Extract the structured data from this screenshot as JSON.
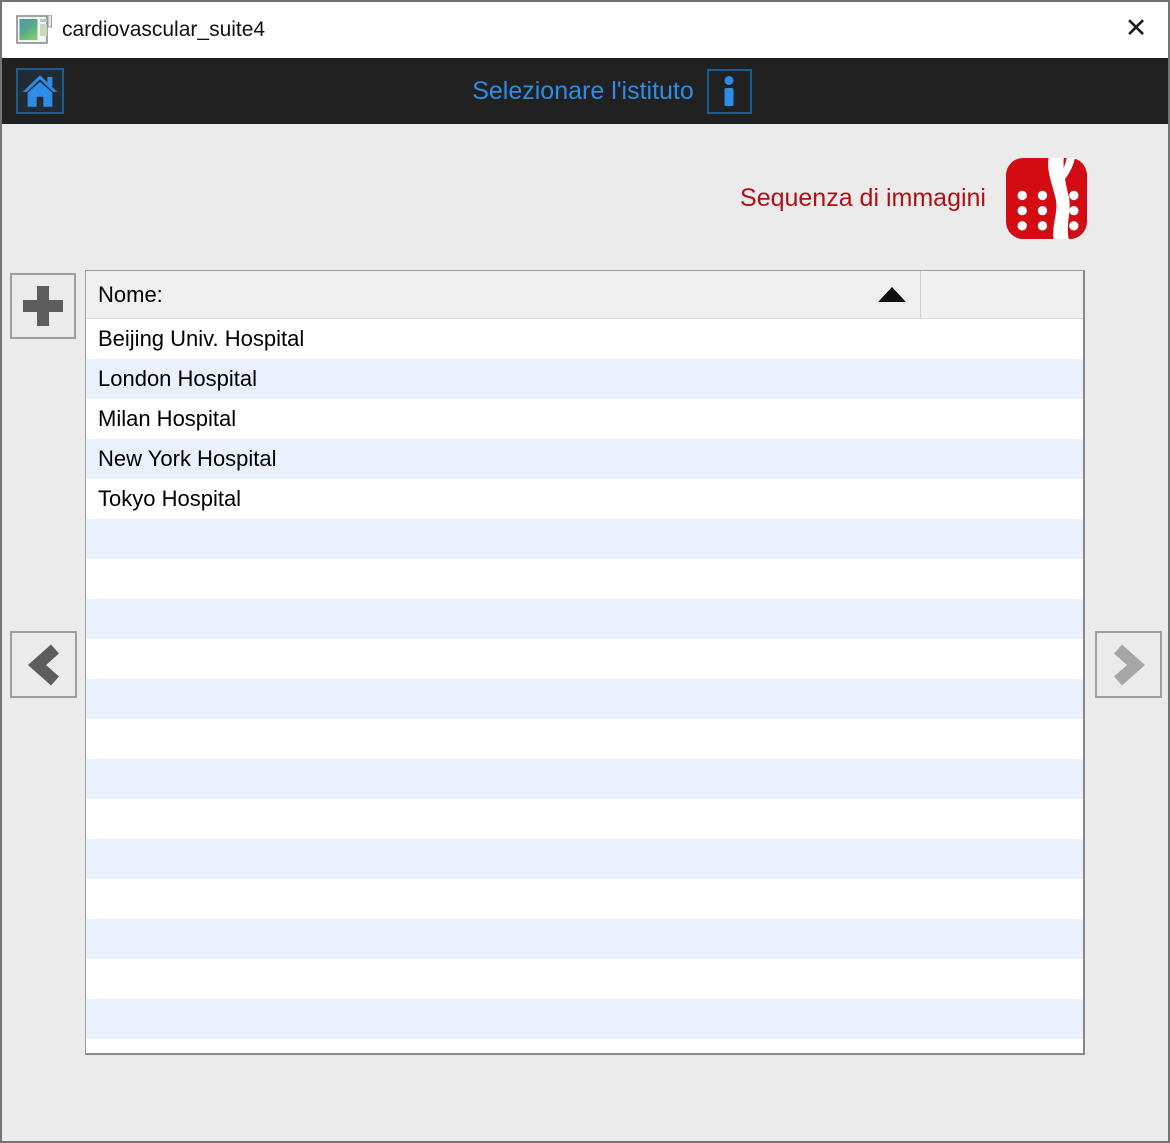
{
  "window": {
    "title": "cardiovascular_suite4",
    "close_glyph": "✕"
  },
  "appbar": {
    "title": "Selezionare l'istituto",
    "home_icon": "home-icon",
    "info_icon": "info-icon"
  },
  "sequence": {
    "label": "Sequenza di immagini",
    "icon": "vessel-angiogram-icon"
  },
  "table": {
    "columns": [
      {
        "label": "Nome:",
        "sort": "ascending"
      },
      {
        "label": ""
      }
    ],
    "rows": [
      "Beijing Univ. Hospital",
      "London Hospital",
      "Milan Hospital",
      "New York Hospital",
      "Tokyo Hospital"
    ]
  },
  "nav": {
    "previous_enabled": true,
    "next_enabled": false
  },
  "colors": {
    "accent_blue": "#2d8ce8",
    "accent_blue_border": "#1d5c8f",
    "appbar_bg": "#212121",
    "red_text": "#b01116",
    "red_icon": "#d20c12",
    "page_bg": "#ebebeb",
    "row_alt": "#eaf1fc"
  }
}
